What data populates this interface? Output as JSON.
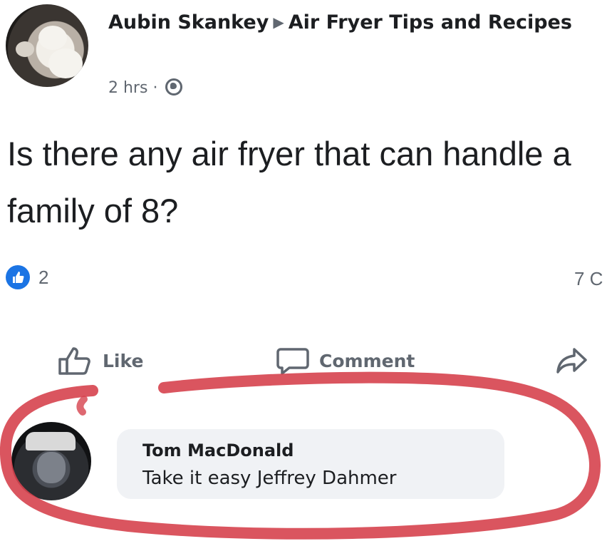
{
  "post": {
    "author": "Aubin Skankey",
    "group": "Air Fryer Tips and Recipes",
    "time": "2 hrs",
    "separator": "·",
    "text": "Is there any air fryer that can handle a family of 8?",
    "reaction_count": "2",
    "comment_count": "7 C"
  },
  "actions": {
    "like_label": "Like",
    "comment_label": "Comment"
  },
  "comment": {
    "author": "Tom MacDonald",
    "text": "Take it easy Jeffrey Dahmer"
  },
  "icons": [
    "globe-icon",
    "like-reaction-icon",
    "thumbs-up-icon",
    "comment-icon",
    "share-icon",
    "triangle-right-icon"
  ],
  "colors": {
    "like_blue": "#1b74e4",
    "secondary_text": "#606770",
    "comment_bubble": "#f0f2f5",
    "annotation_red": "#d6424e"
  }
}
